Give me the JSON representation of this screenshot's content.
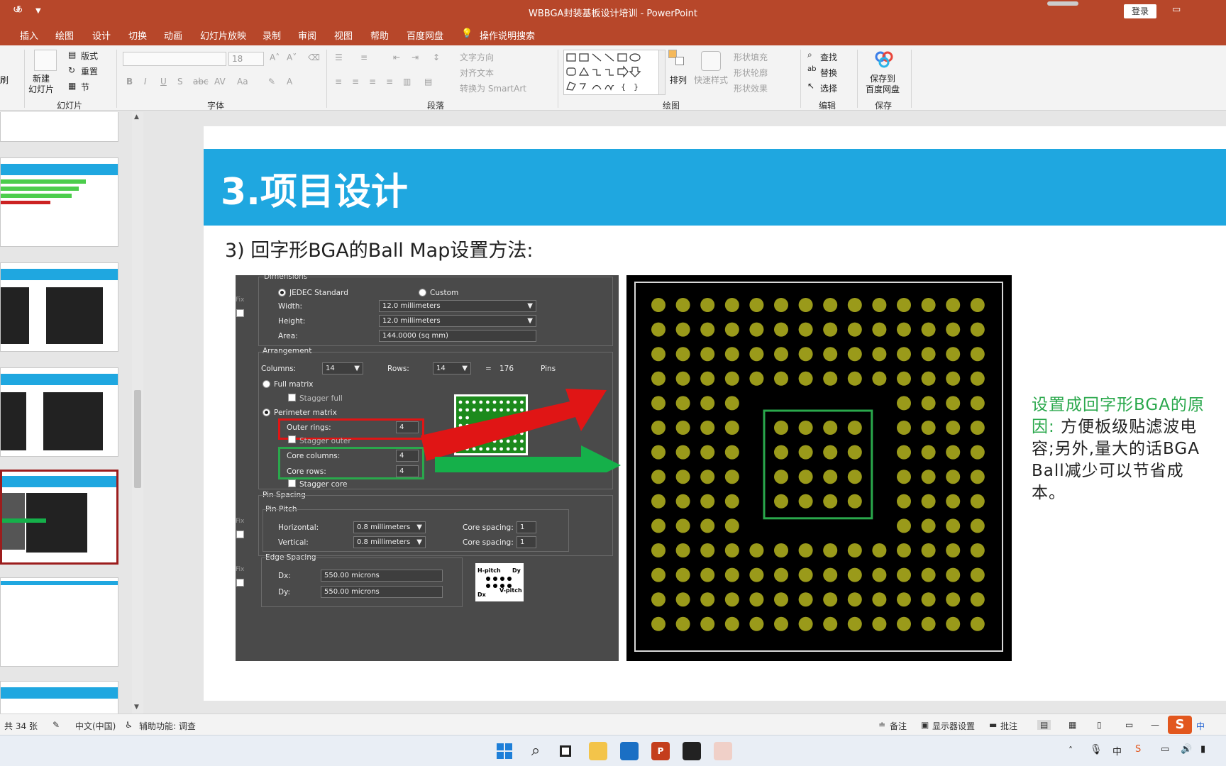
{
  "window": {
    "title": "WBBGA封装基板设计培训 - PowerPoint",
    "login": "登录"
  },
  "tabs": [
    "插入",
    "绘图",
    "设计",
    "切换",
    "动画",
    "幻灯片放映",
    "录制",
    "审阅",
    "视图",
    "帮助",
    "百度网盘",
    "操作说明搜索"
  ],
  "ribbon": {
    "slides": {
      "new_slide": "新建\n幻灯片",
      "layout": "版式",
      "reset": "重置",
      "section": "节",
      "group": "幻灯片",
      "left_cut": "刷"
    },
    "font": {
      "size": "18",
      "group": "字体"
    },
    "paragraph": {
      "text_direction": "文字方向",
      "align_text": "对齐文本",
      "convert_smartart": "转换为 SmartArt",
      "group": "段落"
    },
    "drawing": {
      "arrange": "排列",
      "quick_styles": "快速样式",
      "shape_fill": "形状填充",
      "shape_outline": "形状轮廓",
      "shape_effects": "形状效果",
      "group": "绘图"
    },
    "editing": {
      "find": "查找",
      "replace": "替换",
      "select": "选择",
      "group": "编辑"
    },
    "save": {
      "save_to_baidu": "保存到\n百度网盘",
      "group": "保存"
    }
  },
  "slide": {
    "title": "3.项目设计",
    "subtitle": "3) 回字形BGA的Ball  Map设置方法:",
    "reason_highlight": "设置成回字形BGA的原因:",
    "reason_text": "方便板级贴滤波电容;另外,量大的话BGA Ball减少可以节省成本。"
  },
  "dialog": {
    "dimensions": "Dimensions",
    "jedec": "JEDEC Standard",
    "custom": "Custom",
    "width_label": "Width:",
    "width_value": "12.0 millimeters",
    "height_label": "Height:",
    "height_value": "12.0 millimeters",
    "area_label": "Area:",
    "area_value": "144.0000 (sq mm)",
    "fix": "Fix",
    "arrangement": "Arrangement",
    "columns_label": "Columns:",
    "columns_value": "14",
    "rows_label": "Rows:",
    "rows_value": "14",
    "equals": "=",
    "pins_count": "176",
    "pins_label": "Pins",
    "full_matrix": "Full matrix",
    "stagger_full": "Stagger full",
    "perimeter_matrix": "Perimeter matrix",
    "outer_rings_label": "Outer rings:",
    "outer_rings_value": "4",
    "stagger_outer": "Stagger outer",
    "core_columns_label": "Core columns:",
    "core_columns_value": "4",
    "core_rows_label": "Core rows:",
    "core_rows_value": "4",
    "stagger_core": "Stagger core",
    "pin_spacing": "Pin Spacing",
    "pin_pitch": "Pin Pitch",
    "horizontal_label": "Horizontal:",
    "horizontal_value": "0.8 millimeters",
    "vertical_label": "Vertical:",
    "vertical_value": "0.8 millimeters",
    "core_spacing_label": "Core spacing:",
    "core_spacing_h": "1",
    "core_spacing_v": "1",
    "edge_spacing": "Edge Spacing",
    "dx_label": "Dx:",
    "dx_value": "550.00 microns",
    "dy_label": "Dy:",
    "dy_value": "550.00 microns",
    "pitch_diagram": {
      "h_pitch": "H-pitch",
      "dy": "Dy",
      "dx": "Dx",
      "v_pitch": "V-pitch"
    }
  },
  "bga_map": {
    "grid_size": 14,
    "outer_rings": 4,
    "core_size": 4,
    "ball_color": "#9a9a1a",
    "core_box_color": "#2aa84c"
  },
  "colors": {
    "ppt_red": "#b7472a",
    "slide_header": "#1fa7e0",
    "arrow_red": "#e01515",
    "arrow_green": "#15b04a",
    "reason_green": "#2aa84c"
  },
  "statusbar": {
    "slide_count": "共 34 张",
    "language": "中文(中国)",
    "accessibility": "辅助功能: 调查",
    "notes": "备注",
    "display_settings": "显示器设置",
    "comments": "批注"
  },
  "taskbar": {
    "ime": "中"
  }
}
